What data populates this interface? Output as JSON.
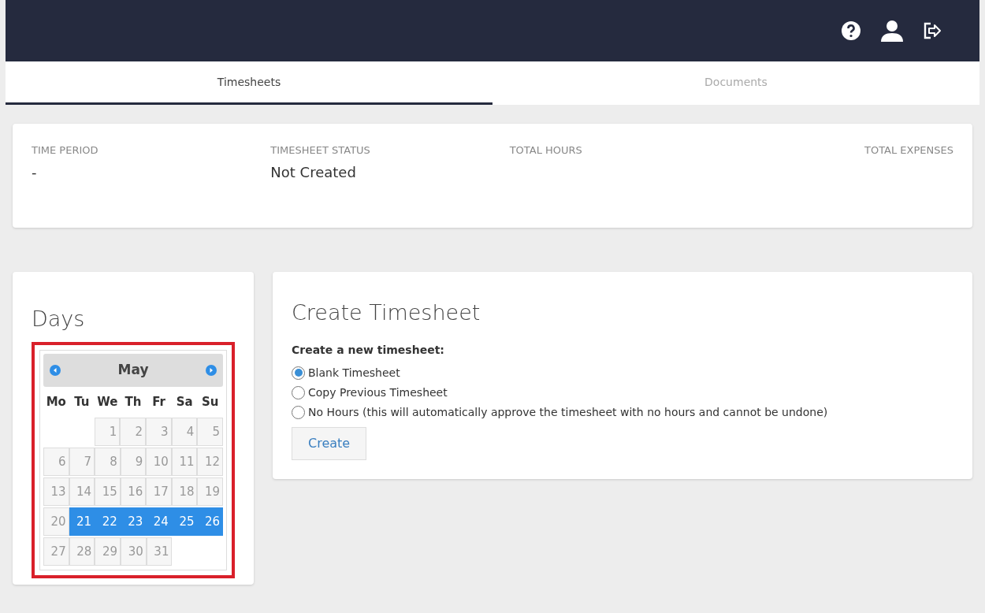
{
  "tabs": [
    {
      "label": "Timesheets",
      "selected": true
    },
    {
      "label": "Documents",
      "selected": false
    }
  ],
  "summary": [
    {
      "label": "TIME PERIOD",
      "value": "-"
    },
    {
      "label": "TIMESHEET STATUS",
      "value": "Not Created"
    },
    {
      "label": "TOTAL HOURS"
    },
    {
      "label": "TOTAL EXPENSES"
    }
  ],
  "days": {
    "title": "Days",
    "calendar": {
      "month": "May",
      "weekdays": [
        "Mo",
        "Tu",
        "We",
        "Th",
        "Fr",
        "Sa",
        "Su"
      ],
      "weeks": [
        [
          {
            "kind": "blank"
          },
          {
            "kind": "blank"
          },
          {
            "kind": "day",
            "day": "1",
            "selected": false
          },
          {
            "kind": "day",
            "day": "2",
            "selected": false
          },
          {
            "kind": "day",
            "day": "3",
            "selected": false
          },
          {
            "kind": "day",
            "day": "4",
            "selected": false
          },
          {
            "kind": "day",
            "day": "5",
            "selected": false
          }
        ],
        [
          {
            "kind": "day",
            "day": "6",
            "selected": false
          },
          {
            "kind": "day",
            "day": "7",
            "selected": false
          },
          {
            "kind": "day",
            "day": "8",
            "selected": false
          },
          {
            "kind": "day",
            "day": "9",
            "selected": false
          },
          {
            "kind": "day",
            "day": "10",
            "selected": false
          },
          {
            "kind": "day",
            "day": "11",
            "selected": false
          },
          {
            "kind": "day",
            "day": "12",
            "selected": false
          }
        ],
        [
          {
            "kind": "day",
            "day": "13",
            "selected": false
          },
          {
            "kind": "day",
            "day": "14",
            "selected": false
          },
          {
            "kind": "day",
            "day": "15",
            "selected": false
          },
          {
            "kind": "day",
            "day": "16",
            "selected": false
          },
          {
            "kind": "day",
            "day": "17",
            "selected": false
          },
          {
            "kind": "day",
            "day": "18",
            "selected": false
          },
          {
            "kind": "day",
            "day": "19",
            "selected": false
          }
        ],
        [
          {
            "kind": "day",
            "day": "20",
            "selected": false
          },
          {
            "kind": "day",
            "day": "21",
            "selected": true
          },
          {
            "kind": "day",
            "day": "22",
            "selected": true
          },
          {
            "kind": "day",
            "day": "23",
            "selected": true
          },
          {
            "kind": "day",
            "day": "24",
            "selected": true
          },
          {
            "kind": "day",
            "day": "25",
            "selected": true
          },
          {
            "kind": "day",
            "day": "26",
            "selected": true
          }
        ],
        [
          {
            "kind": "day",
            "day": "27",
            "selected": false
          },
          {
            "kind": "day",
            "day": "28",
            "selected": false
          },
          {
            "kind": "day",
            "day": "29",
            "selected": false
          },
          {
            "kind": "day",
            "day": "30",
            "selected": false
          },
          {
            "kind": "day",
            "day": "31",
            "selected": false
          },
          {
            "kind": "blank"
          },
          {
            "kind": "blank"
          }
        ]
      ]
    }
  },
  "create": {
    "title": "Create Timesheet",
    "prompt": "Create a new timesheet:",
    "options": [
      {
        "label": "Blank Timesheet",
        "selected": true
      },
      {
        "label": "Copy Previous Timesheet",
        "selected": false
      },
      {
        "label": "No Hours (this will automatically approve the timesheet with no hours and cannot be undone)",
        "selected": false
      }
    ],
    "button": "Create"
  }
}
